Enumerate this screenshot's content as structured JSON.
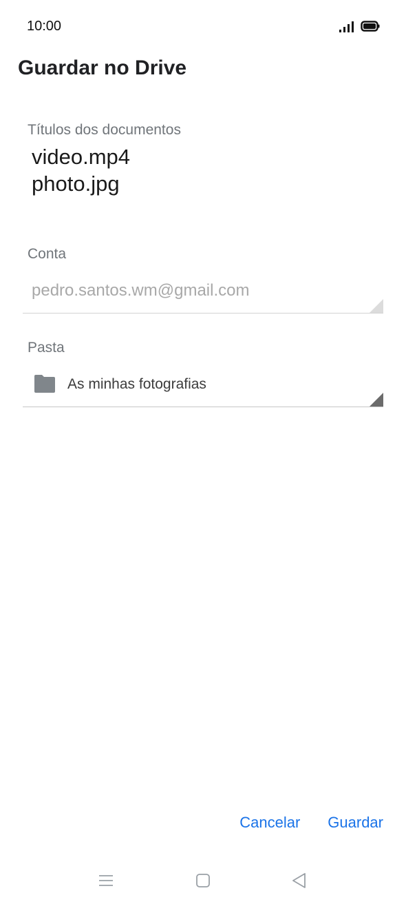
{
  "status_bar": {
    "time": "10:00",
    "signal_icon": "signal-icon",
    "battery_icon": "battery-icon"
  },
  "header": {
    "title": "Guardar no Drive"
  },
  "documents": {
    "label": "Títulos dos documentos",
    "titles": [
      "video.mp4",
      "photo.jpg"
    ]
  },
  "account": {
    "label": "Conta",
    "value": "pedro.santos.wm@gmail.com"
  },
  "folder": {
    "label": "Pasta",
    "icon": "folder-icon",
    "value": "As minhas fotografias"
  },
  "actions": {
    "cancel_label": "Cancelar",
    "save_label": "Guardar"
  },
  "nav_bar": {
    "menu_icon": "menu-icon",
    "home_icon": "home-icon",
    "back_icon": "back-icon"
  },
  "colors": {
    "accent": "#1a73e8",
    "label_gray": "#70757a",
    "disabled_text": "#a8a8a8"
  }
}
